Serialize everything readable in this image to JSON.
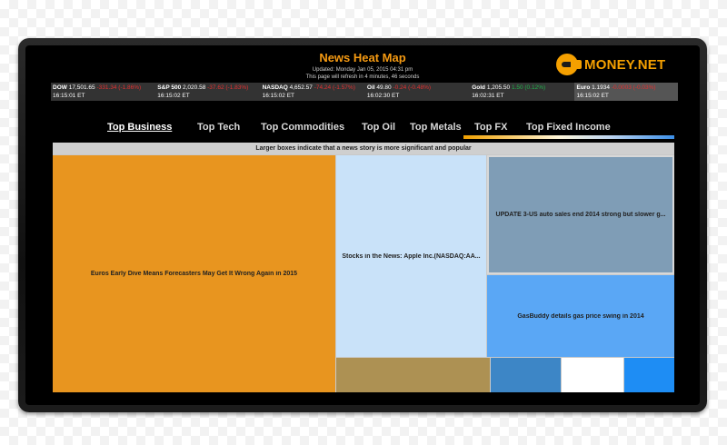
{
  "header": {
    "title": "News Heat Map",
    "updated": "Updated: Monday Jan 05, 2015 04:31 pm",
    "refresh": "This page will refresh in 4 minutes, 46 seconds"
  },
  "logo": {
    "text": "MONEY.NET",
    "icon": "coin-icon"
  },
  "ticker": [
    {
      "name": "DOW",
      "value": "17,501.65",
      "change": "-331.34 (-1.86%)",
      "direction": "down",
      "time": "16:15:01 ET"
    },
    {
      "name": "S&P 500",
      "value": "2,020.58",
      "change": "-37.62 (-1.83%)",
      "direction": "down",
      "time": "16:15:02 ET"
    },
    {
      "name": "NASDAQ",
      "value": "4,652.57",
      "change": "-74.24 (-1.57%)",
      "direction": "down",
      "time": "16:15:02 ET"
    },
    {
      "name": "Oil",
      "value": "49.80",
      "change": "-0.24 (-0.48%)",
      "direction": "down",
      "time": "16:02:30 ET"
    },
    {
      "name": "Gold",
      "value": "1,205.50",
      "change": "1.50 (0.12%)",
      "direction": "up",
      "time": "16:02:31 ET"
    },
    {
      "name": "Euro",
      "value": "1.1934",
      "change": "-0.0003 (-0.03%)",
      "direction": "down",
      "time": "16:15:02 ET"
    }
  ],
  "tabs": [
    {
      "label": "Top Business",
      "active": true
    },
    {
      "label": "Top Tech",
      "active": false
    },
    {
      "label": "Top Commodities",
      "active": false
    },
    {
      "label": "Top Oil",
      "active": false
    },
    {
      "label": "Top Metals",
      "active": false
    },
    {
      "label": "Top FX",
      "active": false
    },
    {
      "label": "Top Fixed Income",
      "active": false
    }
  ],
  "heatmap": {
    "caption": "Larger boxes indicate that a news story is more significant and popular",
    "cells": [
      {
        "label": "Euros Early Dive Means Forecasters May Get It Wrong Again in 2015",
        "color": "#e8951f"
      },
      {
        "label": "Stocks in the News: Apple Inc.(NASDAQ:AA...",
        "color": "#c9e2f9"
      },
      {
        "label": "UPDATE 3-US auto sales end 2014 strong but slower g...",
        "color": "#7f9db6"
      },
      {
        "label": "GasBuddy details gas price swing in 2014",
        "color": "#5aa7f5"
      },
      {
        "label": "",
        "color": "#ad9153"
      },
      {
        "label": "",
        "color": "#3d86c6"
      },
      {
        "label": "",
        "color": "#ffffff"
      },
      {
        "label": "",
        "color": "#1e8df4"
      }
    ]
  },
  "colors": {
    "accent": "#f5a000",
    "negative": "#e23030",
    "positive": "#21b04b"
  }
}
